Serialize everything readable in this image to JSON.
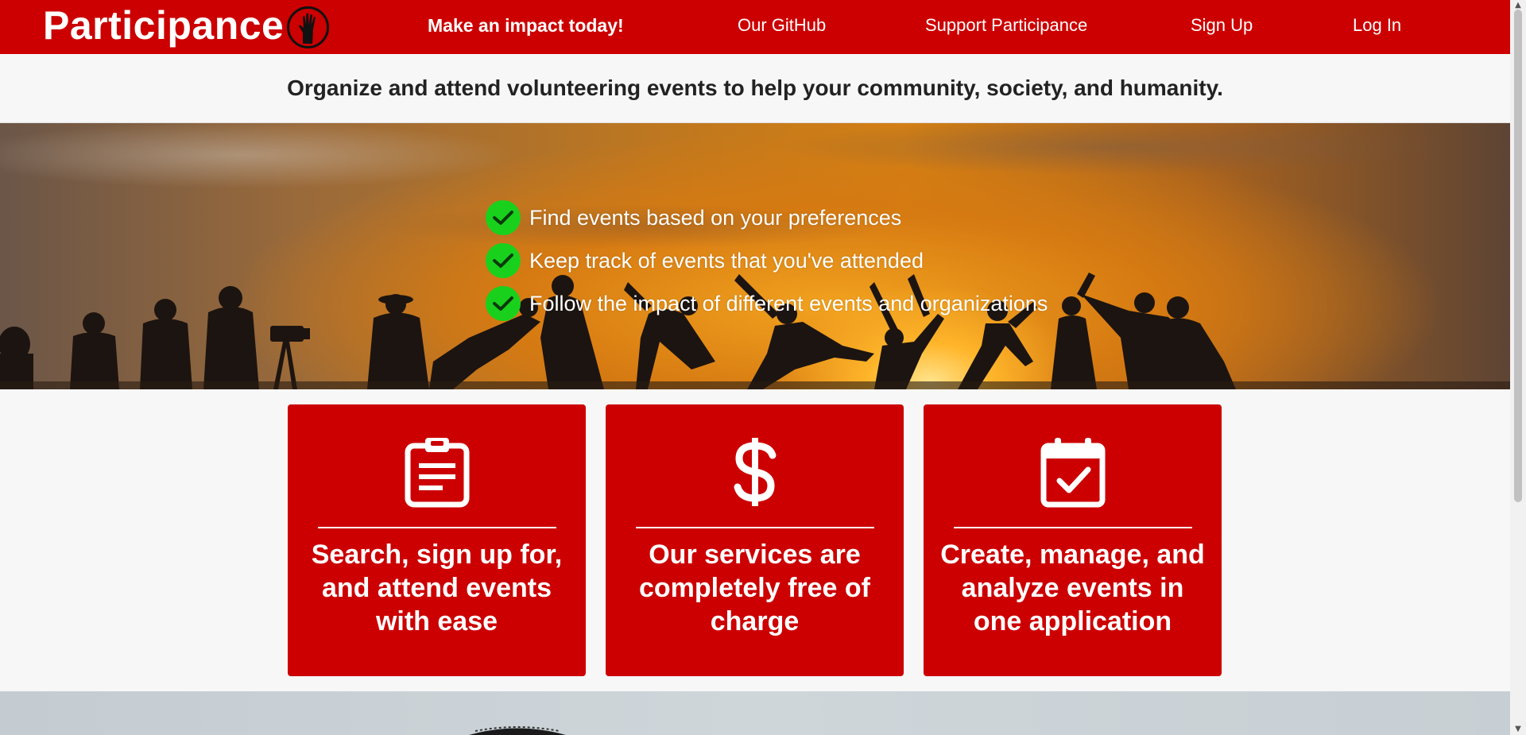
{
  "header": {
    "brand": "Participance",
    "nav": {
      "impact": "Make an impact today!",
      "github": "Our GitHub",
      "support": "Support Participance",
      "signup": "Sign Up",
      "login": "Log In"
    }
  },
  "tagline": "Organize and attend volunteering events to help your community, society, and humanity.",
  "hero": {
    "features": [
      "Find events based on your preferences",
      "Keep track of events that you've attended",
      "Follow the impact of different events and organizations"
    ]
  },
  "cards": [
    {
      "icon": "clipboard-icon",
      "text": "Search, sign up for, and attend events with ease"
    },
    {
      "icon": "dollar-icon",
      "text": "Our services are completely free of charge"
    },
    {
      "icon": "calendar-check-icon",
      "text": "Create, manage, and analyze events in one application"
    }
  ],
  "colors": {
    "brand_red": "#cc0000",
    "check_green": "#19d11c",
    "page_bg": "#f7f7f7"
  }
}
